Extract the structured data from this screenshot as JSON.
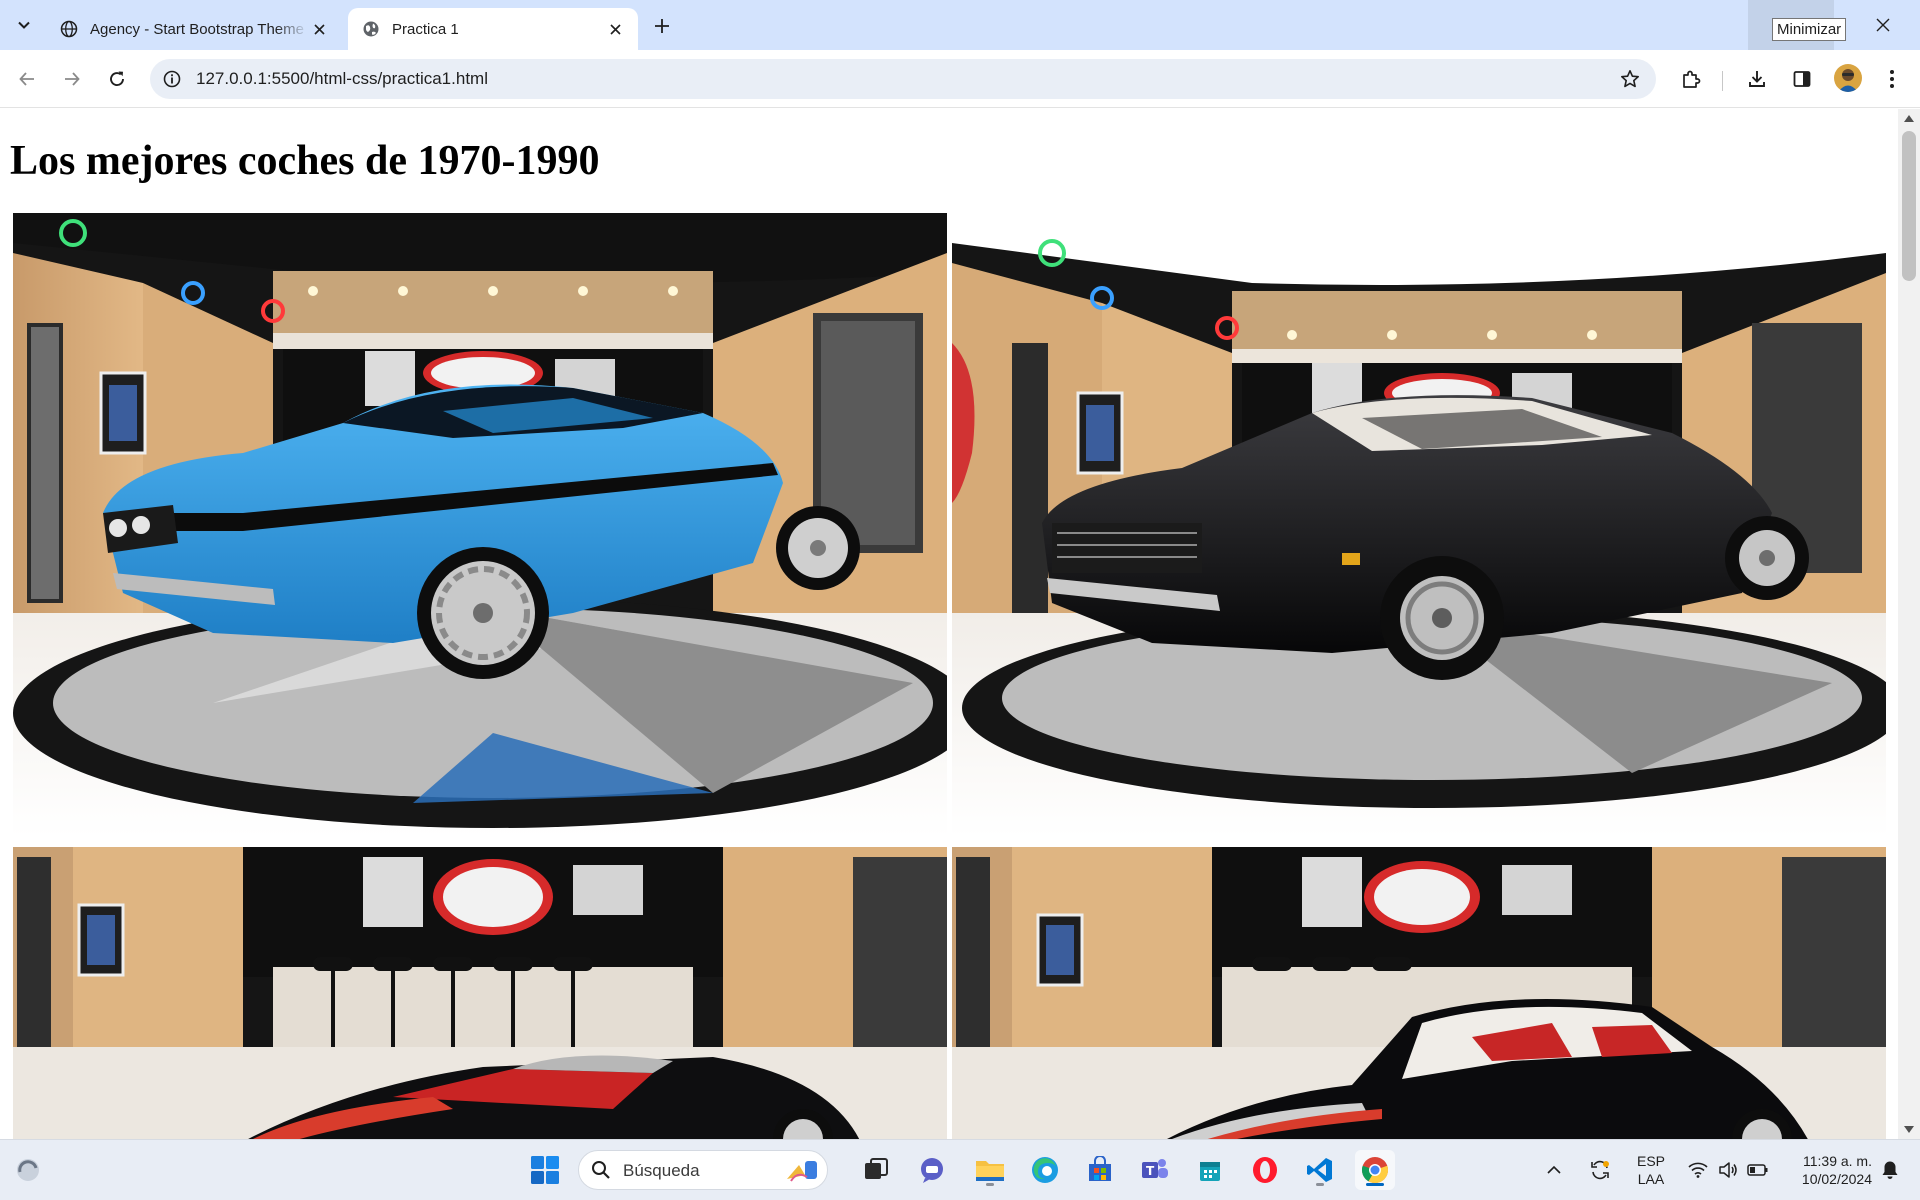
{
  "browser": {
    "tabs": [
      {
        "title": "Agency - Start Bootstrap Theme",
        "active": false,
        "favicon": "globe-icon"
      },
      {
        "title": "Practica 1",
        "active": true,
        "favicon": "globe-icon"
      }
    ],
    "tooltip": "Minimizar",
    "url": "127.0.0.1:5500/html-css/practica1.html"
  },
  "page": {
    "heading": "Los mejores coches de 1970-1990",
    "photos": [
      {
        "subject": "blue muscle car convertible on turntable in showroom",
        "body_color": "#2e9ae0"
      },
      {
        "subject": "black muscle car coupe on turntable in showroom",
        "body_color": "#0d0d0f"
      },
      {
        "subject": "black convertible with red interior in showroom",
        "body_color": "#0e0e10"
      },
      {
        "subject": "black coupe with vinyl top in showroom",
        "body_color": "#0b0b0d"
      }
    ]
  },
  "taskbar": {
    "search_placeholder": "Búsqueda",
    "language": {
      "line1": "ESP",
      "line2": "LAA"
    },
    "clock": {
      "time": "11:39 a. m.",
      "date": "10/02/2024"
    },
    "apps": [
      "windows-start",
      "search",
      "task-view",
      "chat",
      "file-explorer",
      "edge",
      "store",
      "teams",
      "outlook",
      "opera",
      "vscode",
      "chrome"
    ]
  },
  "colors": {
    "tabstrip": "#d3e3fd",
    "omnibox": "#e9eef6",
    "taskbar": "#e8edf5",
    "accent": "#0067c0"
  }
}
